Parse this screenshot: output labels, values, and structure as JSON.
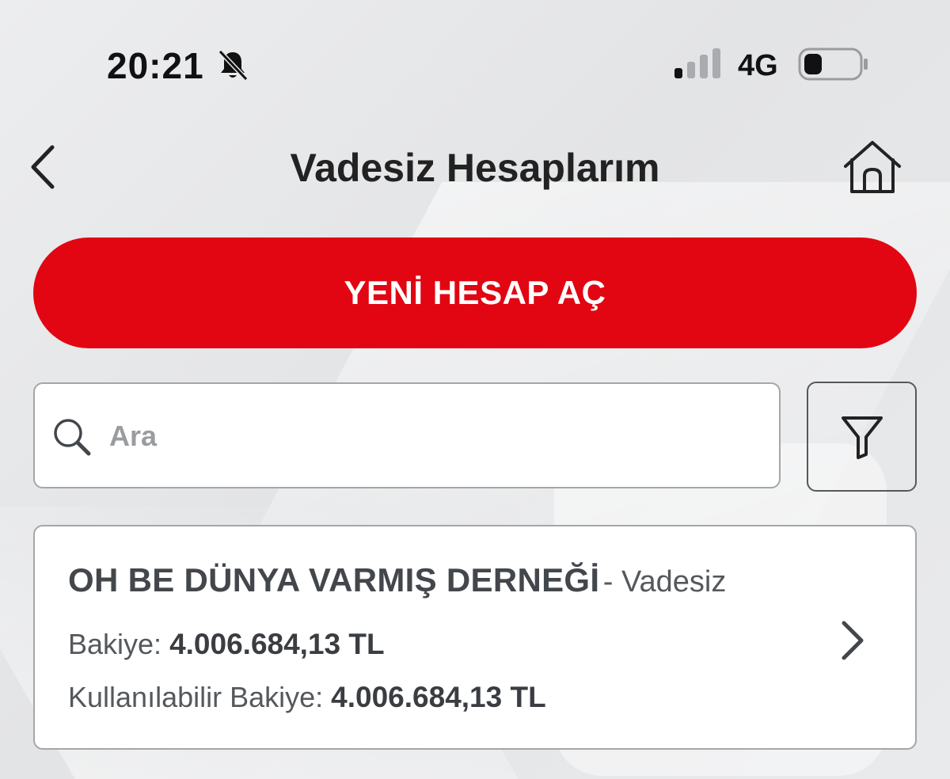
{
  "status_bar": {
    "time": "20:21",
    "network": "4G",
    "icons": [
      "bell-slash-icon",
      "signal-icon",
      "battery-icon"
    ]
  },
  "header": {
    "title": "Vadesiz Hesaplarım",
    "back_icon": "chevron-left-icon",
    "home_icon": "home-icon"
  },
  "new_account_button": {
    "label": "YENİ HESAP AÇ",
    "color": "#e10612"
  },
  "search": {
    "placeholder": "Ara",
    "value": ""
  },
  "filter": {
    "icon": "filter-icon"
  },
  "accounts": [
    {
      "name": "OH BE DÜNYA VARMIŞ DERNEĞİ",
      "type": "- Vadesiz",
      "balance_label": "Bakiye:",
      "balance_value": "4.006.684,13 TL",
      "available_label": "Kullanılabilir Bakiye:",
      "available_value": "4.006.684,13 TL"
    }
  ]
}
